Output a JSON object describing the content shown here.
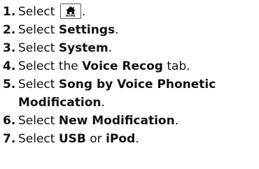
{
  "steps": [
    {
      "num": "1.",
      "text": "Select",
      "icon": "home-icon",
      "icon_label": "HOME",
      "tail": "."
    },
    {
      "num": "2.",
      "pre": "Select ",
      "bold": "Settings",
      "post": "."
    },
    {
      "num": "3.",
      "pre": "Select ",
      "bold": "System",
      "post": "."
    },
    {
      "num": "4.",
      "pre": "Select the ",
      "bold": "Voice Recog",
      "post": " tab."
    },
    {
      "num": "5.",
      "pre": "Select ",
      "bold": "Song by Voice Phonetic Modification",
      "post": "."
    },
    {
      "num": "6.",
      "pre": "Select ",
      "bold": "New Modification",
      "post": "."
    },
    {
      "num": "7.",
      "pre": "Select ",
      "bold": "USB",
      "mid": " or ",
      "bold2": "iPod",
      "post": "."
    }
  ]
}
